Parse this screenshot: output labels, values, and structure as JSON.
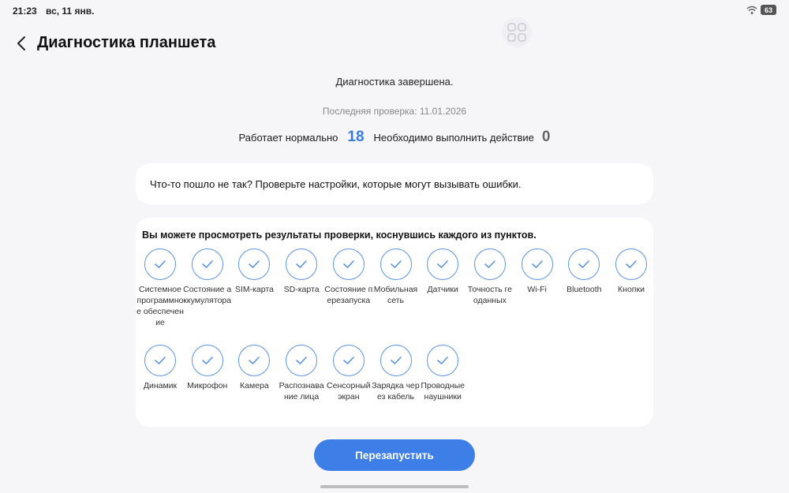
{
  "status_bar": {
    "time": "21:23",
    "date": "вс, 11 янв.",
    "battery": "63"
  },
  "header": {
    "title": "Диагностика планшета"
  },
  "summary": {
    "title": "Диагностика завершена.",
    "last_check": "Последняя проверка: 11.01.2026",
    "ok_label": "Работает нормально",
    "ok_count": "18",
    "action_label": "Необходимо выполнить действие",
    "action_count": "0"
  },
  "hint": {
    "text": "Что-то пошло не так? Проверьте настройки, которые могут вызывать ошибки."
  },
  "results": {
    "title": "Вы можете просмотреть результаты проверки, коснувшись каждого из пунктов.",
    "items": [
      {
        "label": "Системное программное обеспечение"
      },
      {
        "label": "Состояние аккумулятора"
      },
      {
        "label": "SIM-карта"
      },
      {
        "label": "SD-карта"
      },
      {
        "label": "Состояние перезапуска"
      },
      {
        "label": "Мобильная сеть"
      },
      {
        "label": "Датчики"
      },
      {
        "label": "Точность геоданных"
      },
      {
        "label": "Wi-Fi"
      },
      {
        "label": "Bluetooth"
      },
      {
        "label": "Кнопки"
      },
      {
        "label": "Динамик"
      },
      {
        "label": "Микрофон"
      },
      {
        "label": "Камера"
      },
      {
        "label": "Распознавание лица"
      },
      {
        "label": "Сенсорный экран"
      },
      {
        "label": "Зарядка через кабель"
      },
      {
        "label": "Проводные наушники"
      }
    ]
  },
  "restart_button": {
    "label": "Перезапустить"
  },
  "colors": {
    "accent": "#3d7fe6",
    "ok_count": "#3a7de0",
    "background": "#f6f6f8"
  }
}
